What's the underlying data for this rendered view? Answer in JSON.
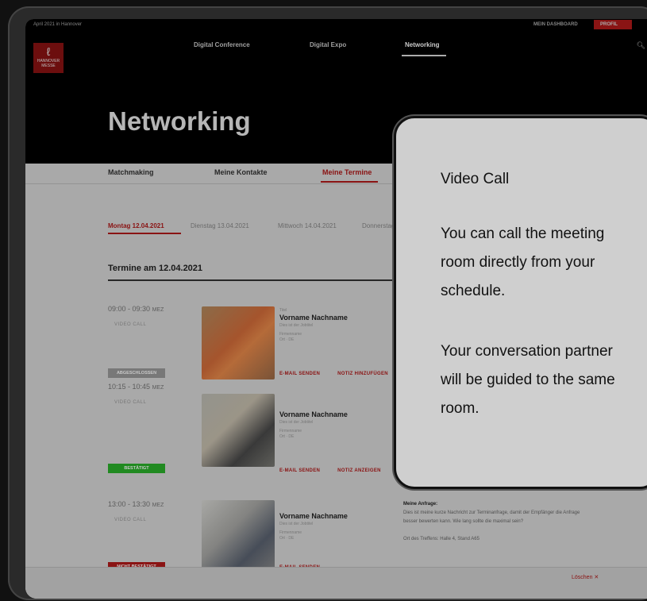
{
  "status_bar": {
    "date": "April 2021 in Hannover",
    "dashboard": "MEIN DASHBOARD",
    "profile": "PROFIL"
  },
  "logo": {
    "text": "HANNOVER MESSE"
  },
  "nav": {
    "items": [
      "Digital Conference",
      "Digital Expo",
      "Networking"
    ],
    "active": "Networking"
  },
  "page_title": "Networking",
  "tabs": {
    "items": [
      "Matchmaking",
      "Meine Kontakte",
      "Meine Termine"
    ],
    "active": "Meine Termine"
  },
  "days": [
    "Montag 12.04.2021",
    "Dienstag 13.04.2021",
    "Mittwoch 14.04.2021",
    "Donnerstag"
  ],
  "termine_heading": "Termine am 12.04.2021",
  "appointments": [
    {
      "time": "09:00 - 09:30",
      "tz": "MEZ",
      "type": "VIDEO CALL",
      "status": "ABGESCHLOSSEN",
      "status_color": "#9a9a9a",
      "title": "Titel",
      "name": "Vorname Nachname",
      "job": "Dies ist der Jobtitel",
      "company": "Firmenname",
      "location": "Ort · DE",
      "actions": [
        "E-MAIL SENDEN",
        "NOTIZ HINZUFÜGEN"
      ]
    },
    {
      "time": "10:15 - 10:45",
      "tz": "MEZ",
      "type": "VIDEO CALL",
      "status": "BESTÄTIGT",
      "status_color": "#2bb12b",
      "title": "",
      "name": "Vorname Nachname",
      "job": "Dies ist der Jobtitel",
      "company": "Firmenname",
      "location": "Ort · DE",
      "actions": [
        "E-MAIL SENDEN",
        "NOTIZ ANZEIGEN"
      ]
    },
    {
      "time": "13:00 - 13:30",
      "tz": "MEZ",
      "type": "VIDEO CALL",
      "status": "NICHT BESTÄTIGT",
      "status_color": "#b11a1a",
      "title": "",
      "name": "Vorname Nachname",
      "job": "Dies ist der Jobtitel",
      "company": "Firmenname",
      "location": "Ort · DE",
      "actions": [
        "E-MAIL SENDEN"
      ]
    }
  ],
  "request": {
    "title": "Meine Anfrage:",
    "text": "Dies ist meine kurze Nachricht zur Terminanfrage, damit der Empfänger die Anfrage besser bewerten kann. Wie lang sollte die maximal sein?",
    "place": "Ort des Treffens: Halle 4, Stand A65"
  },
  "footer": {
    "delete": "Löschen ✕"
  },
  "tooltip": {
    "title": "Video Call",
    "p1": "You can call the meeting\nroom directly from your\nschedule.",
    "p2": "Your conversation partner\nwill be guided to the same\nroom."
  }
}
